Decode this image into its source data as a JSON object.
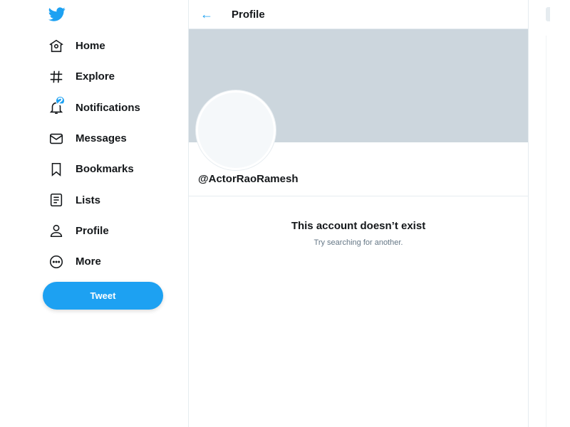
{
  "brand": {
    "color": "#1da1f2"
  },
  "sidebar": {
    "items": [
      {
        "label": "Home",
        "icon": "home-icon"
      },
      {
        "label": "Explore",
        "icon": "hashtag-icon"
      },
      {
        "label": "Notifications",
        "icon": "bell-icon",
        "badge": "2"
      },
      {
        "label": "Messages",
        "icon": "envelope-icon"
      },
      {
        "label": "Bookmarks",
        "icon": "bookmark-icon"
      },
      {
        "label": "Lists",
        "icon": "list-icon"
      },
      {
        "label": "Profile",
        "icon": "person-icon"
      },
      {
        "label": "More",
        "icon": "more-icon"
      }
    ],
    "tweet_label": "Tweet"
  },
  "header": {
    "title": "Profile"
  },
  "profile": {
    "handle": "@ActorRaoRamesh",
    "message_title": "This account doesn’t exist",
    "message_sub": "Try searching for another."
  }
}
